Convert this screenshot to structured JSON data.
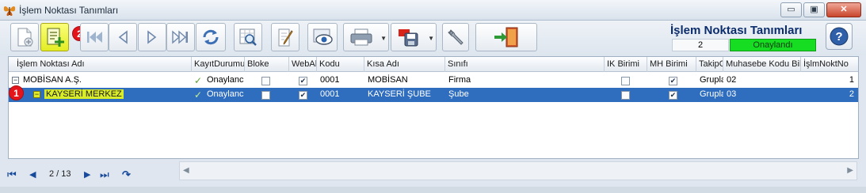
{
  "window": {
    "title": "İşlem Noktası Tanımları",
    "minimize_label": "▭",
    "maximize_label": "▣",
    "close_label": "✕"
  },
  "toolbar": {
    "buttons": [
      {
        "name": "new-document-icon"
      },
      {
        "name": "add-child-icon"
      },
      {
        "name": "first-record-icon"
      },
      {
        "name": "prev-record-icon"
      },
      {
        "name": "next-record-icon"
      },
      {
        "name": "last-record-icon"
      },
      {
        "name": "refresh-icon"
      },
      {
        "name": "search-grid-icon"
      },
      {
        "name": "edit-icon"
      },
      {
        "name": "preview-icon"
      },
      {
        "name": "print-icon"
      },
      {
        "name": "export-pdf-icon"
      },
      {
        "name": "settings-icon"
      },
      {
        "name": "exit-icon"
      }
    ],
    "dropdown_glyph": "▼"
  },
  "panel": {
    "title": "İşlem Noktası Tanımları",
    "number": "2",
    "status": "Onaylandı"
  },
  "markers": {
    "one": "1",
    "two": "2"
  },
  "grid": {
    "columns": {
      "name": "İşlem Noktası Adı",
      "status": "KayıtDurumu",
      "bloke": "Bloke",
      "web": "WebAl",
      "kodu": "Kodu",
      "kisa": "Kısa Adı",
      "sinifi": "Sınıfı",
      "ik": "IK Birimi",
      "mh": "MH Birimi",
      "takip": "TakipG",
      "muhasebe": "Muhasebe Kodu Bile",
      "no": "İşlmNoktNo"
    },
    "rows": [
      {
        "name": "MOBİSAN A.Ş.",
        "status": "Onaylanc",
        "kodu": "0001",
        "kisa": "MOBİSAN",
        "sinifi": "Firma",
        "takip": "Grupla",
        "muhasebe": "02",
        "no": "1",
        "bloke": false,
        "web": true,
        "ik": false,
        "mh": true,
        "selected": false
      },
      {
        "name": "KAYSERİ MERKEZ",
        "status": "Onaylanc",
        "kodu": "0001",
        "kisa": "KAYSERİ ŞUBE",
        "sinifi": "Şube",
        "takip": "Grupla",
        "muhasebe": "03",
        "no": "2",
        "bloke": false,
        "web": true,
        "ik": false,
        "mh": true,
        "selected": true
      }
    ]
  },
  "navigator": {
    "position": "2 / 13",
    "first": "⏮",
    "prev": "◀",
    "next": "▶",
    "last": "⏭",
    "refresh": "↷"
  },
  "glyphs": {
    "collapse": "−",
    "check": "✓",
    "tick": "✔"
  },
  "colors": {
    "selected_row": "#2f6dbf",
    "highlight": "#e2ec24",
    "status_ok": "#17dd22",
    "marker": "#e4141b"
  }
}
